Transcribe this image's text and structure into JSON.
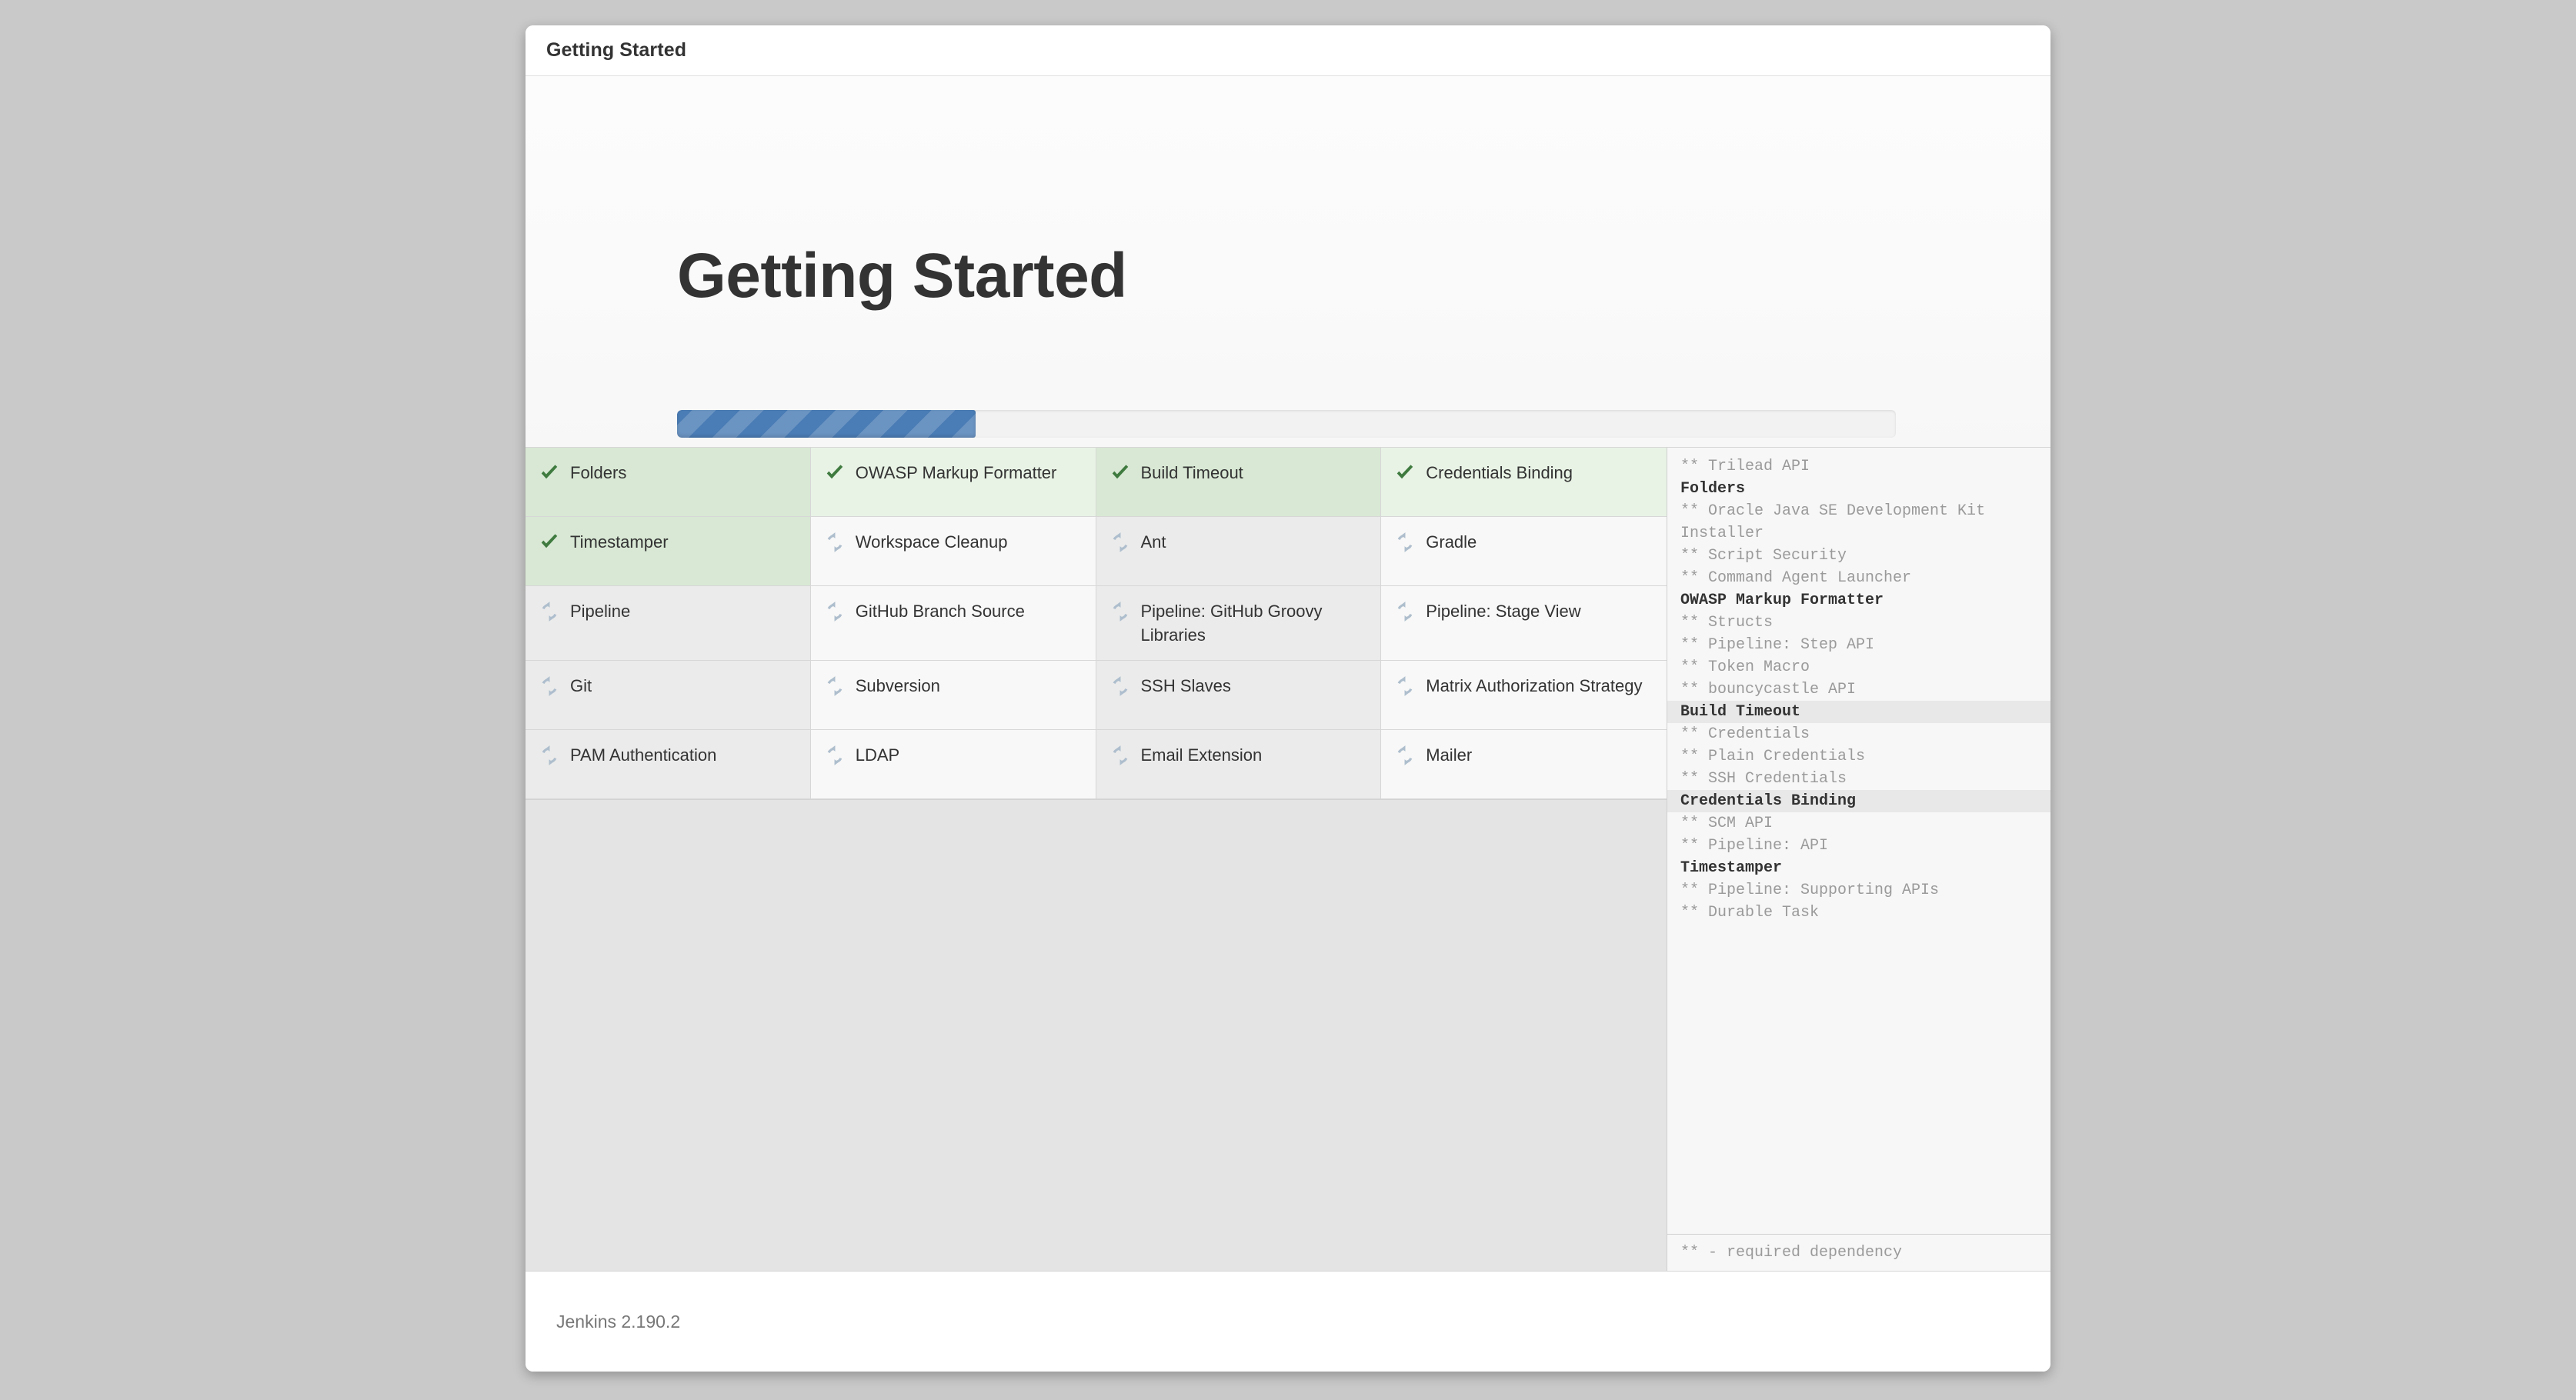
{
  "window": {
    "titlebar_title": "Getting Started"
  },
  "hero": {
    "heading": "Getting Started",
    "progress": {
      "percent": 24.5,
      "accent_color": "#4a7cb5",
      "track_color": "#f2f2f2"
    }
  },
  "plugins": {
    "icon_done": "check-icon",
    "icon_pending": "refresh-spinner-icon",
    "color_done": "#3f7a3f",
    "color_pending": "#aebecd",
    "items": [
      {
        "label": "Folders",
        "status": "done"
      },
      {
        "label": "OWASP Markup Formatter",
        "status": "done"
      },
      {
        "label": "Build Timeout",
        "status": "done"
      },
      {
        "label": "Credentials Binding",
        "status": "done"
      },
      {
        "label": "Timestamper",
        "status": "done"
      },
      {
        "label": "Workspace Cleanup",
        "status": "pending"
      },
      {
        "label": "Ant",
        "status": "pending"
      },
      {
        "label": "Gradle",
        "status": "pending"
      },
      {
        "label": "Pipeline",
        "status": "pending"
      },
      {
        "label": "GitHub Branch Source",
        "status": "pending"
      },
      {
        "label": "Pipeline: GitHub Groovy Libraries",
        "status": "pending"
      },
      {
        "label": "Pipeline: Stage View",
        "status": "pending"
      },
      {
        "label": "Git",
        "status": "pending"
      },
      {
        "label": "Subversion",
        "status": "pending"
      },
      {
        "label": "SSH Slaves",
        "status": "pending"
      },
      {
        "label": "Matrix Authorization Strategy",
        "status": "pending"
      },
      {
        "label": "PAM Authentication",
        "status": "pending"
      },
      {
        "label": "LDAP",
        "status": "pending"
      },
      {
        "label": "Email Extension",
        "status": "pending"
      },
      {
        "label": "Mailer",
        "status": "pending"
      }
    ]
  },
  "log": {
    "lines": [
      {
        "text": "** Trilead API",
        "kind": "dep"
      },
      {
        "text": "Folders",
        "kind": "plugin",
        "highlight": false
      },
      {
        "text": "** Oracle Java SE Development Kit Installer",
        "kind": "dep"
      },
      {
        "text": "** Script Security",
        "kind": "dep"
      },
      {
        "text": "** Command Agent Launcher",
        "kind": "dep"
      },
      {
        "text": "OWASP Markup Formatter",
        "kind": "plugin",
        "highlight": false
      },
      {
        "text": "** Structs",
        "kind": "dep"
      },
      {
        "text": "** Pipeline: Step API",
        "kind": "dep"
      },
      {
        "text": "** Token Macro",
        "kind": "dep"
      },
      {
        "text": "** bouncycastle API",
        "kind": "dep"
      },
      {
        "text": "Build Timeout",
        "kind": "plugin",
        "highlight": true
      },
      {
        "text": "** Credentials",
        "kind": "dep"
      },
      {
        "text": "** Plain Credentials",
        "kind": "dep"
      },
      {
        "text": "** SSH Credentials",
        "kind": "dep"
      },
      {
        "text": "Credentials Binding",
        "kind": "plugin",
        "highlight": true
      },
      {
        "text": "** SCM API",
        "kind": "dep"
      },
      {
        "text": "** Pipeline: API",
        "kind": "dep"
      },
      {
        "text": "Timestamper",
        "kind": "plugin",
        "highlight": false
      },
      {
        "text": "** Pipeline: Supporting APIs",
        "kind": "dep"
      },
      {
        "text": "** Durable Task",
        "kind": "dep"
      }
    ],
    "legend": "** - required dependency"
  },
  "footer": {
    "version_text": "Jenkins 2.190.2"
  }
}
